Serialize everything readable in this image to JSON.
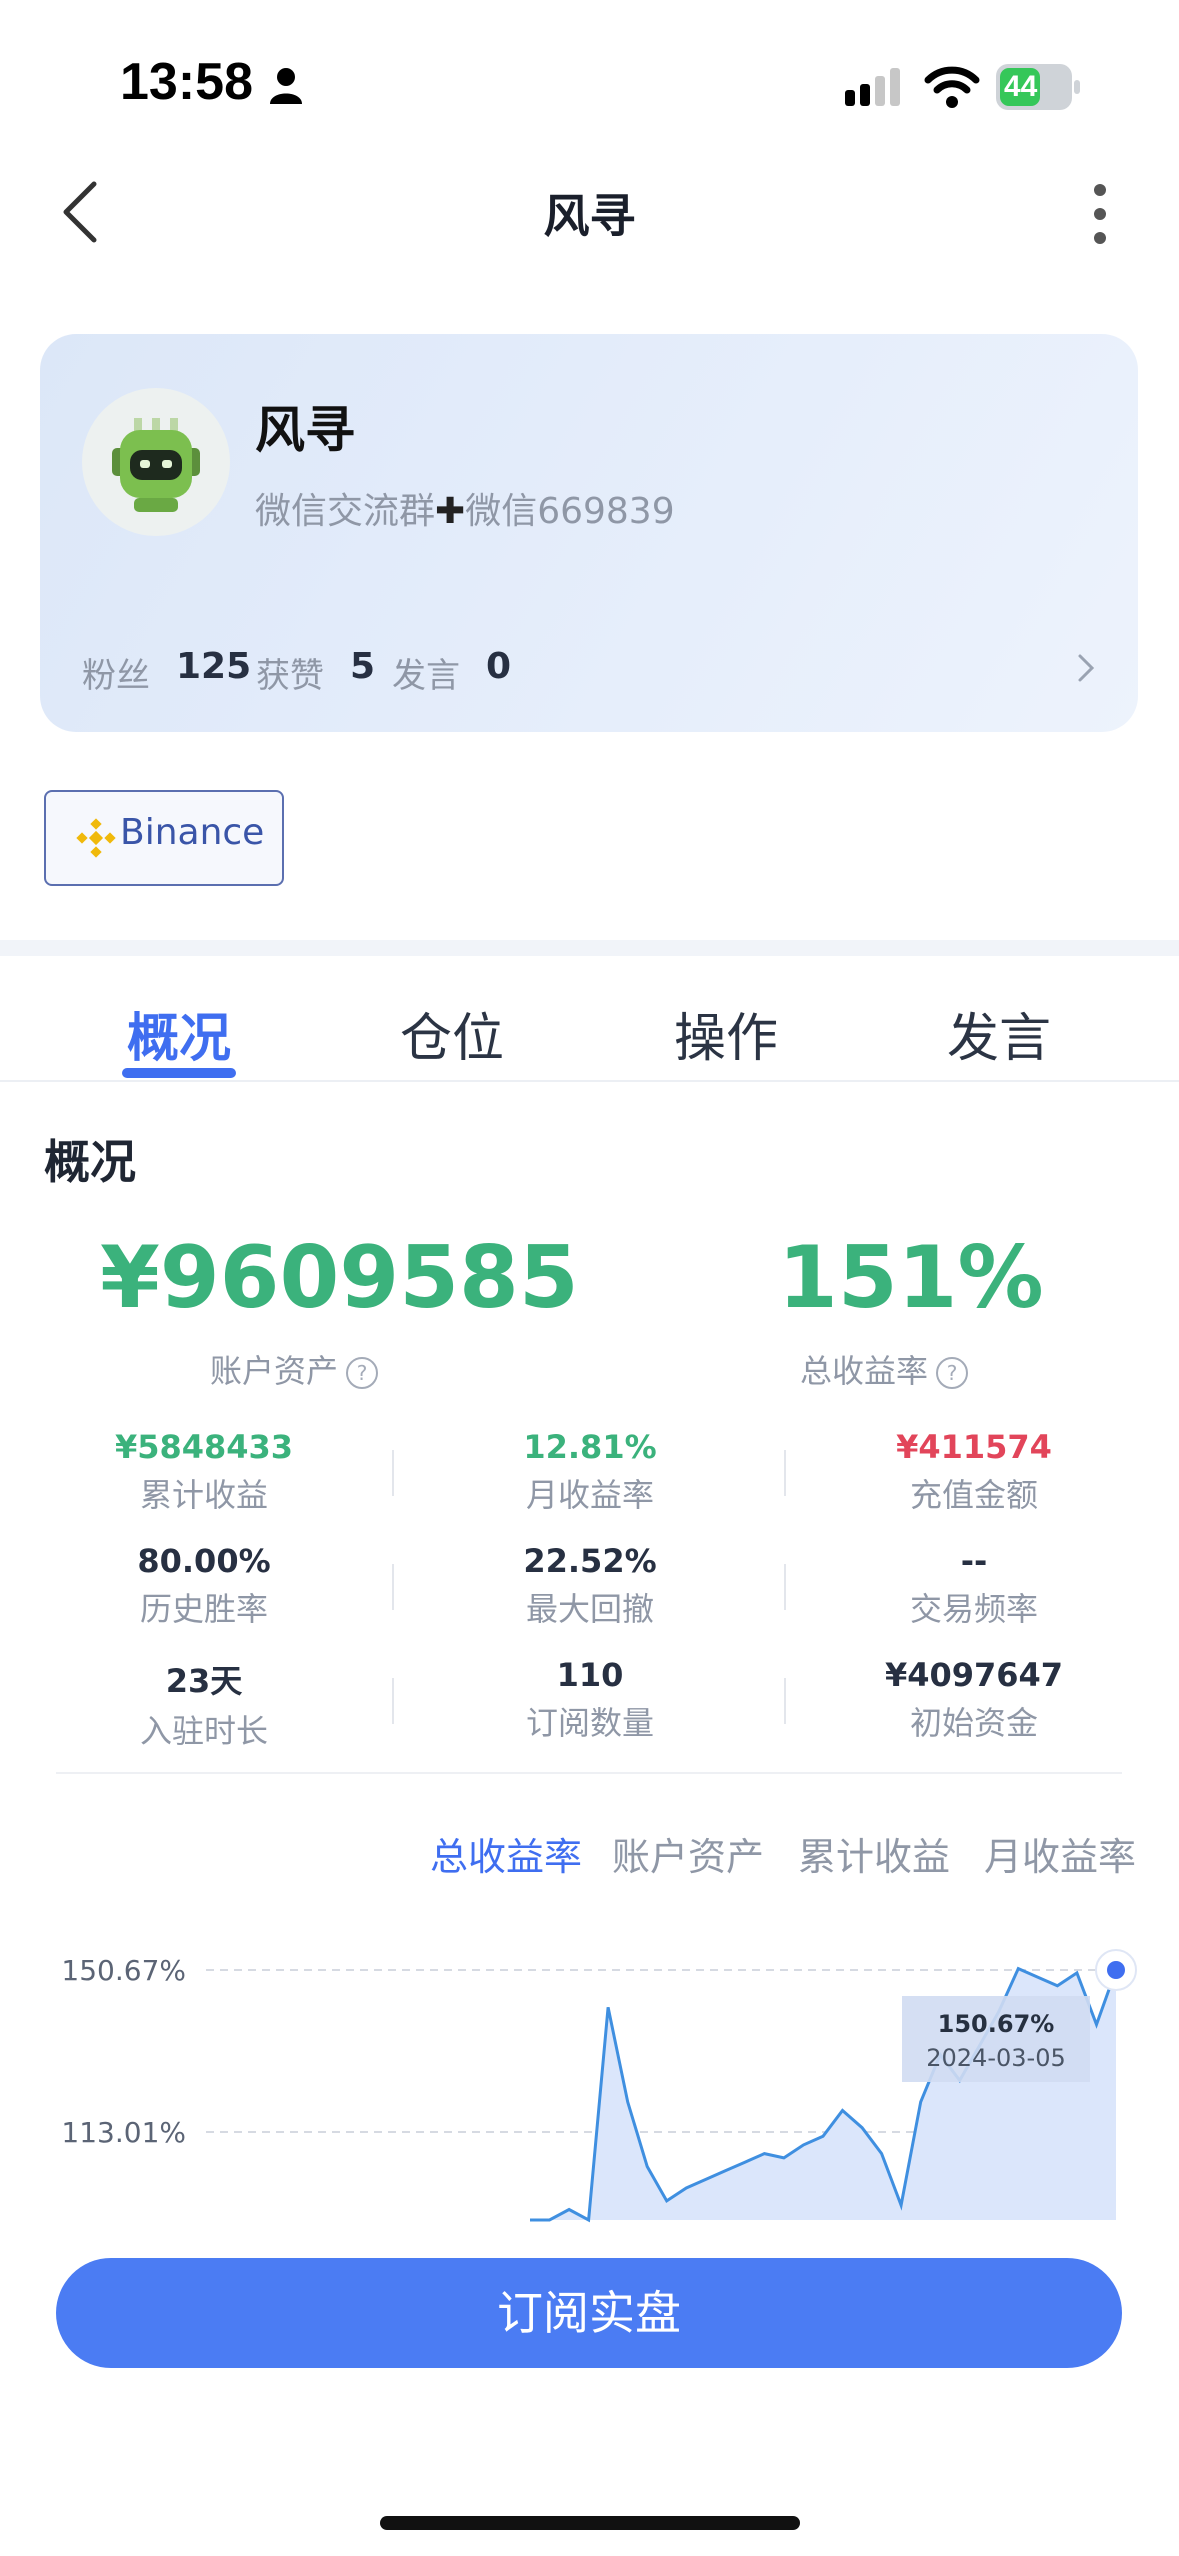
{
  "status_bar": {
    "time": "13:58",
    "battery": "44"
  },
  "nav": {
    "title": "风寻"
  },
  "profile": {
    "name": "风寻",
    "desc_prefix": "微信交流群",
    "desc_suffix": "微信669839",
    "stats": [
      {
        "label": "粉丝",
        "value": "125"
      },
      {
        "label": "获赞",
        "value": "5"
      },
      {
        "label": "发言",
        "value": "0"
      }
    ]
  },
  "exchange": {
    "label": "Binance",
    "accent": "#f0b90b"
  },
  "tabs": [
    "概况",
    "仓位",
    "操作",
    "发言"
  ],
  "section_title": "概况",
  "summary": {
    "assets_value": "¥9609585",
    "assets_label": "账户资产",
    "return_value": "151%",
    "return_label": "总收益率"
  },
  "grid": [
    {
      "value": "¥5848433",
      "label": "累计收益",
      "color": "#3bb27c"
    },
    {
      "value": "12.81%",
      "label": "月收益率",
      "color": "#3bb27c"
    },
    {
      "value": "¥411574",
      "label": "充值金额",
      "color": "#e2455a"
    },
    {
      "value": "80.00%",
      "label": "历史胜率",
      "color": "#273042"
    },
    {
      "value": "22.52%",
      "label": "最大回撤",
      "color": "#273042"
    },
    {
      "value": "--",
      "label": "交易频率",
      "color": "#273042"
    },
    {
      "value": "23天",
      "label": "入驻时长",
      "color": "#273042"
    },
    {
      "value": "110",
      "label": "订阅数量",
      "color": "#273042"
    },
    {
      "value": "¥4097647",
      "label": "初始资金",
      "color": "#273042"
    }
  ],
  "chart_tabs": [
    "总收益率",
    "账户资产",
    "累计收益",
    "月收益率"
  ],
  "chart_data": {
    "type": "area",
    "y_ticks": [
      "150.67%",
      "113.01%"
    ],
    "y_tick_values": [
      150.67,
      113.01
    ],
    "tooltip": {
      "value": "150.67%",
      "date": "2024-03-05"
    },
    "values": [
      88,
      90,
      95,
      91,
      142,
      120,
      105,
      97,
      100,
      102,
      104,
      106,
      108,
      107,
      110,
      112,
      118,
      114,
      108,
      96,
      120,
      131,
      125,
      133,
      141,
      151,
      149,
      147,
      150,
      138,
      150.67
    ],
    "color": "#3f8fe0"
  },
  "subscribe_label": "订阅实盘"
}
